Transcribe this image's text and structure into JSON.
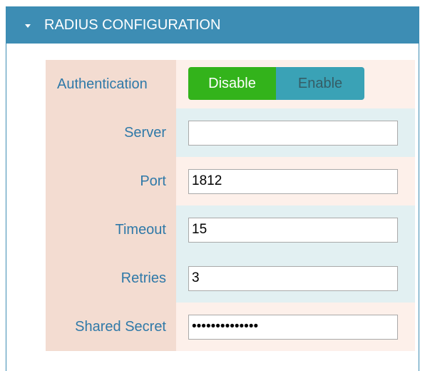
{
  "panel": {
    "title": "RADIUS CONFIGURATION",
    "collapse_icon": "caret-down-icon",
    "header_color": "#3d8db4"
  },
  "authentication": {
    "label": "Authentication",
    "options": [
      "Disable",
      "Enable"
    ],
    "selected": "Disable",
    "selected_color": "#33b31b",
    "unselected_color": "#3aa2b6"
  },
  "server": {
    "label": "Server",
    "value": ""
  },
  "port": {
    "label": "Port",
    "value": "1812"
  },
  "timeout": {
    "label": "Timeout",
    "value": "15"
  },
  "retries": {
    "label": "Retries",
    "value": "3"
  },
  "shared_secret": {
    "label": "Shared Secret",
    "value": "••••••••••••••"
  }
}
